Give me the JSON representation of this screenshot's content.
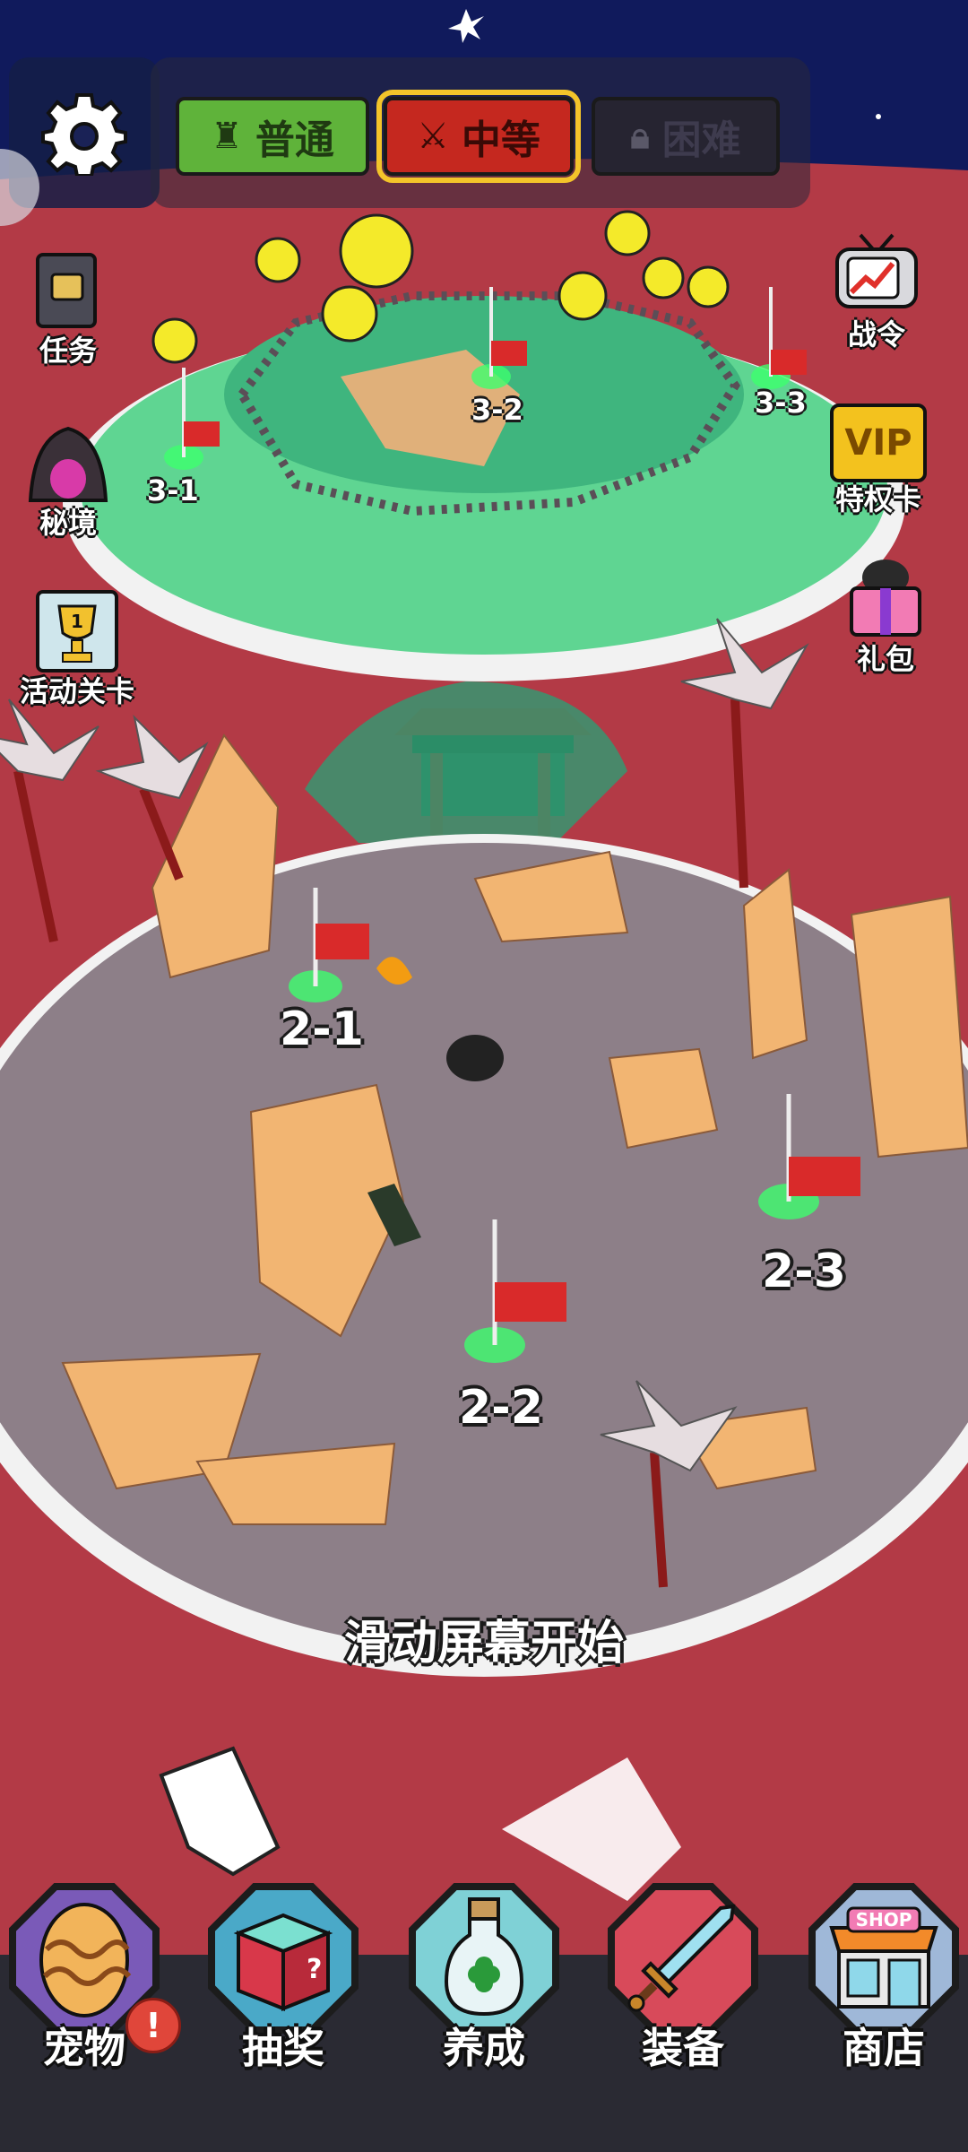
{
  "top_bar": {
    "difficulty_normal": "普通",
    "difficulty_medium": "中等",
    "difficulty_hard": "困难",
    "selected": "中等"
  },
  "side_left": {
    "tasks": "任务",
    "secret_realm": "秘境",
    "event_stage": "活动关卡",
    "trophy_number": "1"
  },
  "side_right": {
    "battle_pass": "战令",
    "vip_badge": "VIP",
    "privilege_card": "特权卡",
    "gift_pack": "礼包"
  },
  "levels": {
    "l31": "3-1",
    "l32": "3-2",
    "l33": "3-3",
    "l21": "2-1",
    "l22": "2-2",
    "l23": "2-3"
  },
  "hint": "滑动屏幕开始",
  "bottom_nav": {
    "pet": "宠物",
    "pet_badge": "!",
    "lottery": "抽奖",
    "cultivate": "养成",
    "equipment": "装备",
    "shop": "商店",
    "shop_sign": "SHOP"
  },
  "colors": {
    "sky": "#101a5c",
    "sea": "#b33a46",
    "island_green": "#5fd592",
    "island_sand": "#8d7f88",
    "medium_accent": "#c5281f",
    "normal_accent": "#5fb33a"
  }
}
